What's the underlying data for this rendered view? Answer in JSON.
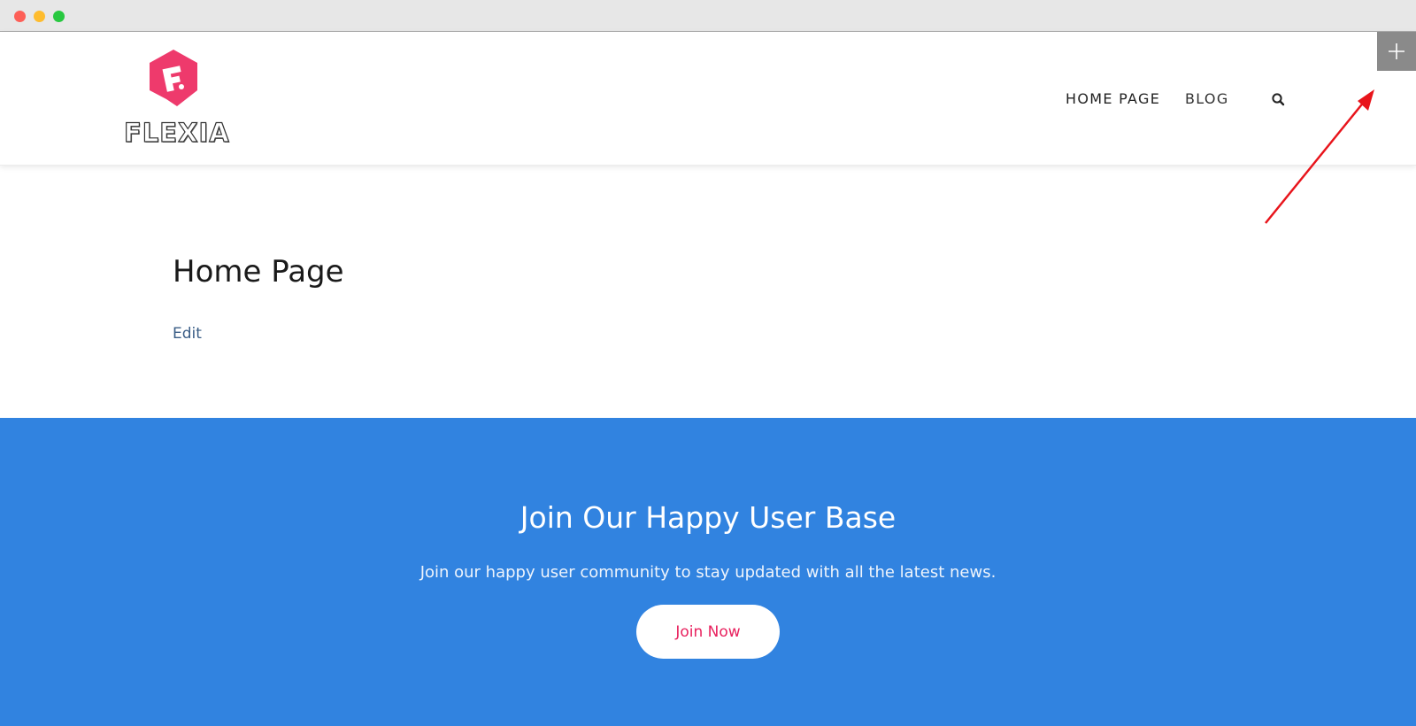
{
  "brand": {
    "name": "FLEXIA",
    "accent_color": "#ee3a6c"
  },
  "nav": {
    "items": [
      {
        "label": "HOME PAGE"
      },
      {
        "label": "BLOG"
      }
    ],
    "search_icon": "search-icon"
  },
  "toolbar": {
    "plus_icon": "plus-icon"
  },
  "page": {
    "title": "Home Page",
    "edit_label": "Edit"
  },
  "cta": {
    "title": "Join Our Happy User Base",
    "text": "Join our happy user community to stay updated with all the latest news.",
    "button_label": "Join Now",
    "background_color": "#3183e0",
    "button_text_color": "#e8215e"
  },
  "annotation": {
    "arrow_color": "#e8141b"
  }
}
